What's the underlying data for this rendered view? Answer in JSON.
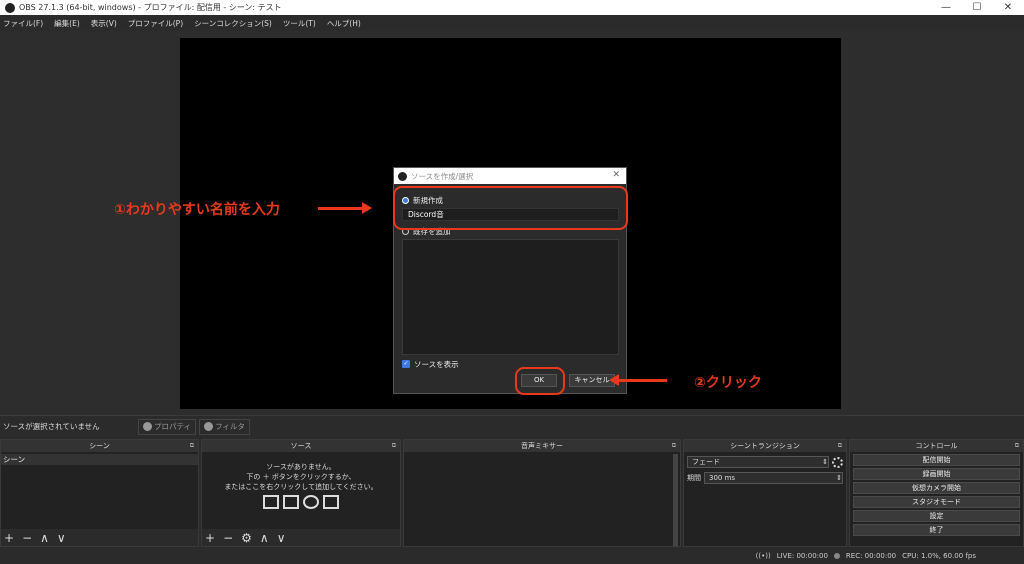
{
  "window": {
    "title": "OBS 27.1.3 (64-bit, windows) - プロファイル: 配信用 - シーン: テスト",
    "minimize": "—",
    "maximize": "☐",
    "close": "✕"
  },
  "menu": [
    "ファイル(F)",
    "編集(E)",
    "表示(V)",
    "プロファイル(P)",
    "シーンコレクション(S)",
    "ツール(T)",
    "ヘルプ(H)"
  ],
  "status_strip": {
    "no_source": "ソースが選択されていません",
    "properties": "プロパティ",
    "filters": "フィルタ"
  },
  "docks": {
    "scenes": {
      "title": "シーン",
      "items": [
        "シーン"
      ]
    },
    "sources": {
      "title": "ソース",
      "empty_line1": "ソースがありません。",
      "empty_line2": "下の ＋ ボタンをクリックするか、",
      "empty_line3": "またはここを右クリックして追加してください。"
    },
    "mixer": {
      "title": "音声ミキサー"
    },
    "transitions": {
      "title": "シーントランジション",
      "selected": "フェード",
      "duration_label": "期間",
      "duration_value": "300 ms"
    },
    "controls": {
      "title": "コントロール",
      "buttons": [
        "配信開始",
        "録画開始",
        "仮想カメラ開始",
        "スタジオモード",
        "設定",
        "終了"
      ]
    }
  },
  "toolbar_glyphs": {
    "add": "+",
    "remove": "−",
    "up": "∧",
    "down": "∨",
    "gear": "⚙"
  },
  "bottom_status": {
    "live": "LIVE: 00:00:00",
    "rec": "REC: 00:00:00",
    "cpu": "CPU: 1.0%, 60.00 fps"
  },
  "dialog": {
    "title": "ソースを作成/選択",
    "create_new": "新規作成",
    "name_value": "Discord音",
    "add_existing": "既存を追加",
    "show_source": "ソースを表示",
    "ok": "OK",
    "cancel": "キャンセル"
  },
  "annotations": {
    "step1": "①わかりやすい名前を入力",
    "step2": "②クリック",
    "color": "#e8391d"
  }
}
